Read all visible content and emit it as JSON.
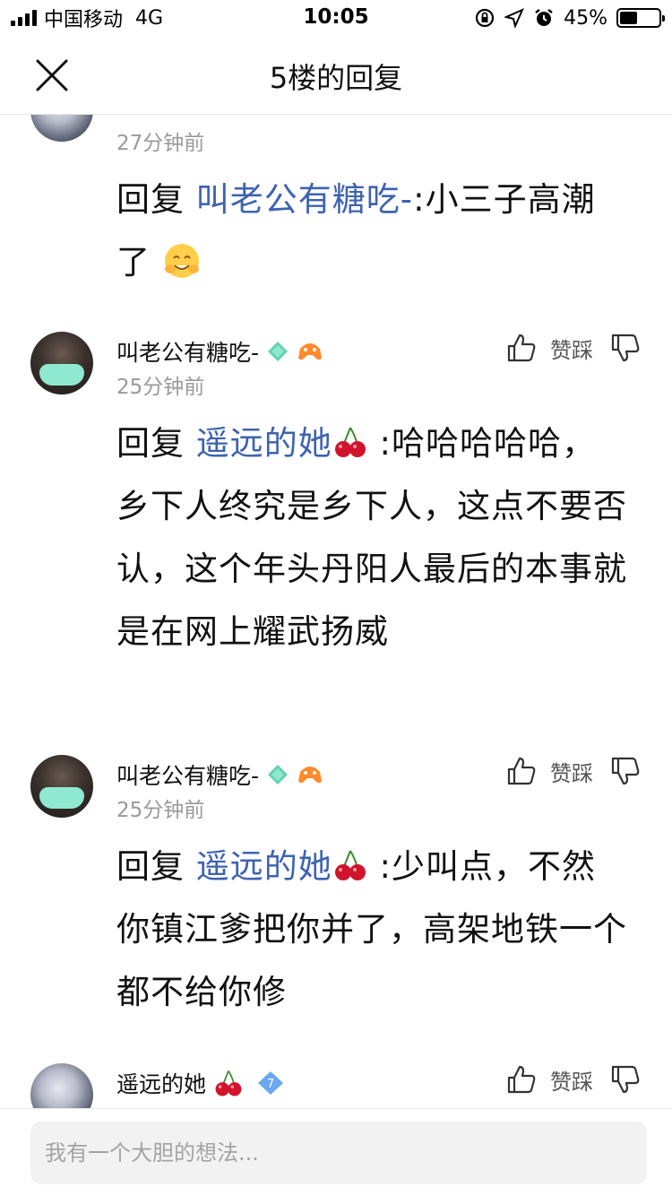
{
  "status_bar": {
    "carrier": "中国移动",
    "network": "4G",
    "time": "10:05",
    "battery_percent": "45%",
    "battery_level": 0.45
  },
  "nav": {
    "title": "5楼的回复"
  },
  "comments": [
    {
      "username": "",
      "time": "27分钟前",
      "reply_prefix": "回复",
      "mention": "叫老公有糖吃-",
      "text": ":小三子高潮了"
    },
    {
      "username": "叫老公有糖吃-",
      "time": "25分钟前",
      "action_label": "赞踩",
      "reply_prefix": "回复",
      "mention": "遥远的她",
      "text": ":哈哈哈哈哈，乡下人终究是乡下人，这点不要否认，这个年头丹阳人最后的本事就是在网上耀武扬威"
    },
    {
      "username": "叫老公有糖吃-",
      "time": "25分钟前",
      "action_label": "赞踩",
      "reply_prefix": "回复",
      "mention": "遥远的她",
      "text": ":少叫点，不然你镇江爹把你并了，高架地铁一个都不给你修"
    },
    {
      "username": "遥远的她",
      "level_badge": "7",
      "action_label": "赞踩"
    }
  ],
  "input": {
    "placeholder": "我有一个大胆的想法..."
  },
  "colors": {
    "mention": "#3d63b0",
    "time": "#9a9a9a",
    "badge_teal": "#5fd3b0",
    "badge_blue": "#6aa8f0"
  },
  "icons": [
    "signal-icon",
    "lock-rotation-icon",
    "location-icon",
    "alarm-icon",
    "battery-icon",
    "close-icon",
    "thumbs-up-icon",
    "thumbs-down-icon",
    "gem-badge-icon",
    "game-badge-icon",
    "cherry-emoji-icon",
    "smile-emoji-icon"
  ]
}
